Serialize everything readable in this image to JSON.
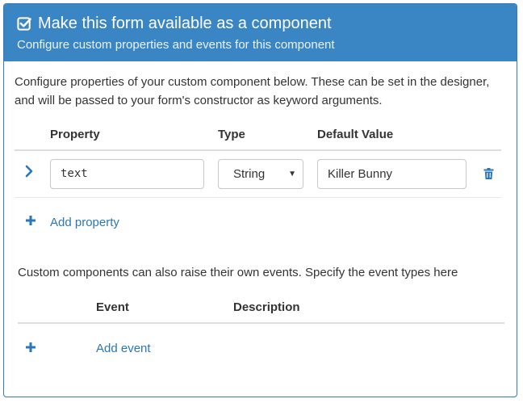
{
  "header": {
    "title": "Make this form available as a component",
    "subtitle": "Configure custom properties and events for this component"
  },
  "properties": {
    "intro": "Configure properties of your custom component below. These can be set in the designer, and will be passed to your form's constructor as keyword arguments.",
    "columns": {
      "property": "Property",
      "type": "Type",
      "default_value": "Default Value"
    },
    "rows": [
      {
        "name": "text",
        "type": "String",
        "default_value": "Killer Bunny"
      }
    ],
    "add_label": "Add property"
  },
  "events": {
    "intro": "Custom components can also raise their own events. Specify the event types here",
    "columns": {
      "event": "Event",
      "description": "Description"
    },
    "add_label": "Add event"
  },
  "colors": {
    "accent": "#3a86c5",
    "link": "#2a76b7",
    "border": "#dddddd"
  },
  "icons": [
    "checkbox-checked-icon",
    "chevron-right-icon",
    "trash-icon",
    "plus-icon"
  ]
}
